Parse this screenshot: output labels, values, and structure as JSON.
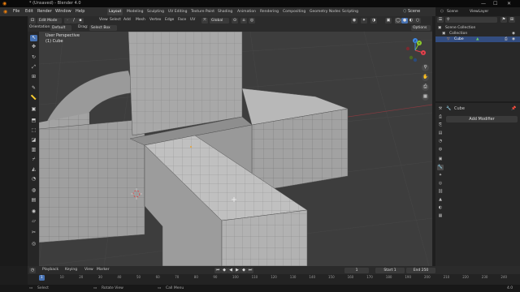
{
  "window": {
    "title": "* (Unsaved) - Blender 4.0",
    "minimize": "—",
    "maximize": "☐",
    "close": "✕"
  },
  "menu": {
    "items": [
      "File",
      "Edit",
      "Render",
      "Window",
      "Help"
    ]
  },
  "workspaces": [
    "Layout",
    "Modeling",
    "Sculpting",
    "UV Editing",
    "Texture Paint",
    "Shading",
    "Animation",
    "Rendering",
    "Compositing",
    "Geometry Nodes",
    "Scripting"
  ],
  "active_workspace": "Layout",
  "scene": {
    "scene_label": "Scene",
    "view_layer_label": "ViewLayer"
  },
  "viewport_header": {
    "mode": "Edit Mode",
    "menus": [
      "View",
      "Select",
      "Add",
      "Mesh",
      "Vertex",
      "Edge",
      "Face",
      "UV"
    ],
    "transform_orientation": "Global",
    "options": "Options"
  },
  "tool_settings": {
    "orientation_label": "Orientation:",
    "orientation_value": "Default",
    "drag_label": "Drag:",
    "drag_value": "Select Box"
  },
  "viewport": {
    "view_name": "User Perspective",
    "object_name": "(1) Cube"
  },
  "gizmo": {
    "x": "X",
    "y": "Y",
    "z": "Z"
  },
  "outliner": {
    "search_placeholder": "",
    "rows": [
      {
        "label": "Scene Collection",
        "indent": 0,
        "selected": false
      },
      {
        "label": "Collection",
        "indent": 1,
        "selected": false
      },
      {
        "label": "Cube",
        "indent": 2,
        "selected": true
      }
    ]
  },
  "properties": {
    "object_name": "Cube",
    "add_modifier": "Add Modifier"
  },
  "timeline": {
    "menus": [
      "Playback",
      "Keying",
      "View",
      "Marker"
    ],
    "current_frame": "1",
    "start_label": "Start",
    "start": "1",
    "end_label": "End",
    "end": "250",
    "ticks": [
      "1",
      "10",
      "20",
      "30",
      "40",
      "50",
      "60",
      "70",
      "80",
      "90",
      "100",
      "110",
      "120",
      "130",
      "140",
      "150",
      "160",
      "170",
      "180",
      "190",
      "200",
      "210",
      "220",
      "230",
      "240",
      "250"
    ]
  },
  "status": {
    "select": "Select",
    "rotate": "Rotate View",
    "call_menu": "Call Menu",
    "version": "4.0"
  },
  "colors": {
    "accent": "#4772b3",
    "x_axis": "#e6434e",
    "y_axis": "#8ccb2d",
    "z_axis": "#3f8ae6",
    "selected_row": "#334d80"
  },
  "icons": [
    "blender-logo-icon",
    "cursor-icon",
    "move-icon",
    "rotate-icon",
    "scale-icon",
    "transform-icon",
    "annotate-icon",
    "measure-icon",
    "add-cube-icon",
    "extrude-icon",
    "inset-icon",
    "bevel-icon",
    "loop-cut-icon",
    "knife-icon",
    "poly-build-icon",
    "spin-icon",
    "smooth-icon",
    "edge-slide-icon",
    "shrink-icon",
    "shear-icon",
    "rip-icon",
    "zoom-icon",
    "hand-icon",
    "camera-icon",
    "grid-icon",
    "wrench-icon"
  ]
}
